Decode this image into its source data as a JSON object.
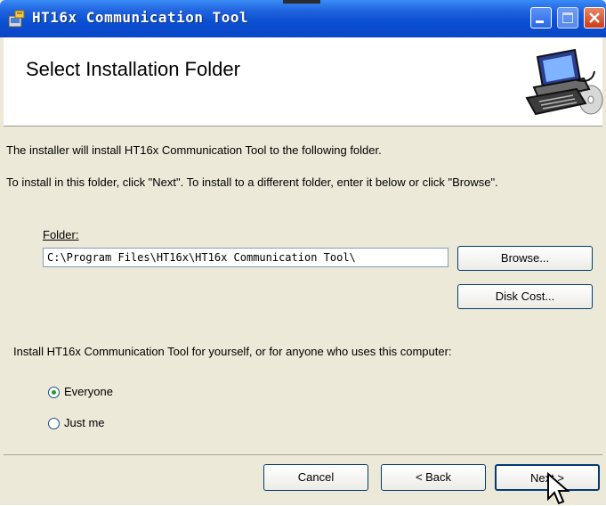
{
  "window": {
    "title": "HT16x Communication Tool"
  },
  "banner": {
    "heading": "Select Installation Folder"
  },
  "content": {
    "line1": "The installer will install HT16x Communication Tool to the following folder.",
    "line2": "To install in this folder, click \"Next\". To install to a different folder, enter it below or click \"Browse\".",
    "folder_label": "Folder:",
    "folder_value": "C:\\Program Files\\HT16x\\HT16x Communication Tool\\",
    "browse_label": "Browse...",
    "disk_cost_label": "Disk Cost...",
    "install_for_text": "Install HT16x Communication Tool for yourself, or for anyone who uses this computer:",
    "radio_options": [
      {
        "label": "Everyone",
        "selected": true
      },
      {
        "label": "Just me",
        "selected": false
      }
    ]
  },
  "footer": {
    "cancel_label": "Cancel",
    "back_label": "< Back",
    "next_label": "Next >"
  },
  "icons": [
    "app-installer-icon",
    "minimize-icon",
    "maximize-icon",
    "close-icon",
    "computer-cd-icon",
    "mouse-cursor-icon"
  ],
  "colors": {
    "titlebar": "#0a4fd3",
    "close_button": "#cc3b1a",
    "dialog_background": "#ece9d8",
    "radio_selected": "#21a121"
  }
}
